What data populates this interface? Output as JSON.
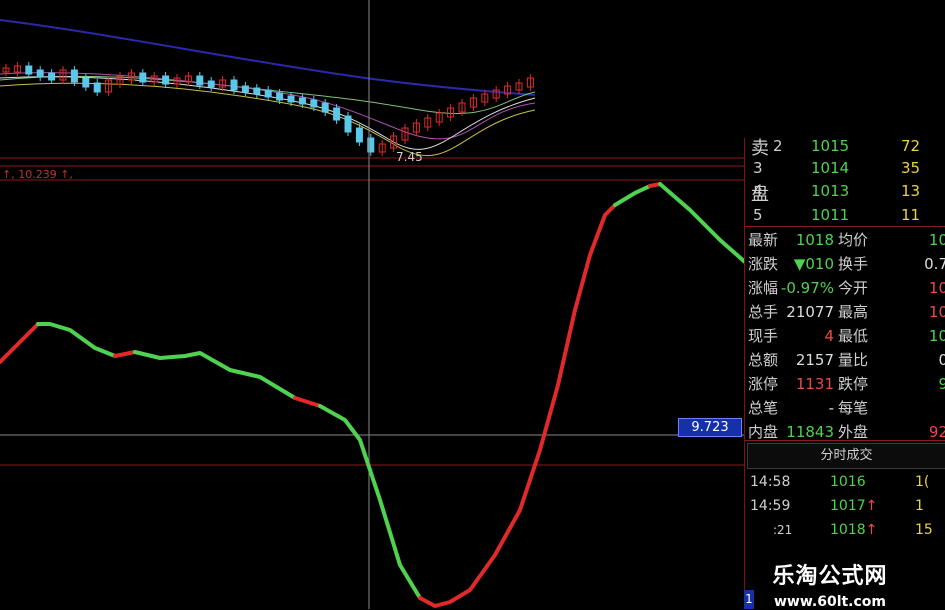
{
  "top_chart": {
    "marker_low_label": "7.45",
    "indicator_label": "↑, 10.239 ↑,"
  },
  "indicator": {
    "price_tag": "9.723"
  },
  "order_book": {
    "sell_side_label": "卖",
    "buy_side_label": "盘",
    "rows": [
      {
        "level": "2",
        "price": "1015",
        "volume": "72"
      },
      {
        "level": "3",
        "price": "1014",
        "volume": "35"
      },
      {
        "level": "4",
        "price": "1013",
        "volume": "13"
      },
      {
        "level": "5",
        "price": "1011",
        "volume": "11"
      }
    ]
  },
  "quote": {
    "rows": [
      {
        "label": "最新",
        "value": "1018",
        "value_color": "#4fd24f",
        "label2": "均价",
        "value2": "10",
        "value2_color": "#4fd24f"
      },
      {
        "label": "涨跌",
        "value": "▼010",
        "value_color": "#4fd24f",
        "label2": "换手",
        "value2": "0.7",
        "value2_color": "#ddd"
      },
      {
        "label": "涨幅",
        "value": "-0.97%",
        "value_color": "#4fd24f",
        "label2": "今开",
        "value2": "10",
        "value2_color": "#e84a4a"
      },
      {
        "label": "总手",
        "value": "21077",
        "value_color": "#ddd",
        "label2": "最高",
        "value2": "10",
        "value2_color": "#e84a4a"
      },
      {
        "label": "现手",
        "value": "4",
        "value_color": "#e84a4a",
        "label2": "最低",
        "value2": "10",
        "value2_color": "#4fd24f"
      },
      {
        "label": "总额",
        "value": "2157",
        "value_color": "#ddd",
        "label2": "量比",
        "value2": "0",
        "value2_color": "#ddd"
      },
      {
        "label": "涨停",
        "value": "1131",
        "value_color": "#e84a4a",
        "label2": "跌停",
        "value2": "9",
        "value2_color": "#4fd24f"
      },
      {
        "label": "总笔",
        "value": "-",
        "value_color": "#ddd",
        "label2": "每笔",
        "value2": "",
        "value2_color": "#ddd"
      },
      {
        "label": "内盘",
        "value": "11843",
        "value_color": "#4fd24f",
        "label2": "外盘",
        "value2": "92",
        "value2_color": "#e84a4a"
      }
    ]
  },
  "trades": {
    "button_label": "分时成交",
    "rows": [
      {
        "time": "14:58",
        "price": "1016",
        "arrow": "",
        "volume": "1("
      },
      {
        "time": "14:59",
        "price": "1017",
        "arrow": "↑",
        "volume": "1"
      },
      {
        "time": ":21",
        "price": "1018",
        "arrow": "↑",
        "volume": "15"
      }
    ],
    "page_indicator": "1"
  },
  "watermark": {
    "title": "乐淘公式网",
    "url": "www.60lt.com"
  },
  "colors": {
    "rising": "#e02a2a",
    "falling": "#4fd24f",
    "grid_line": "#8b1a1a",
    "cross_line": "#8a8a8a",
    "ma_blue": "#2a2aa8"
  }
}
